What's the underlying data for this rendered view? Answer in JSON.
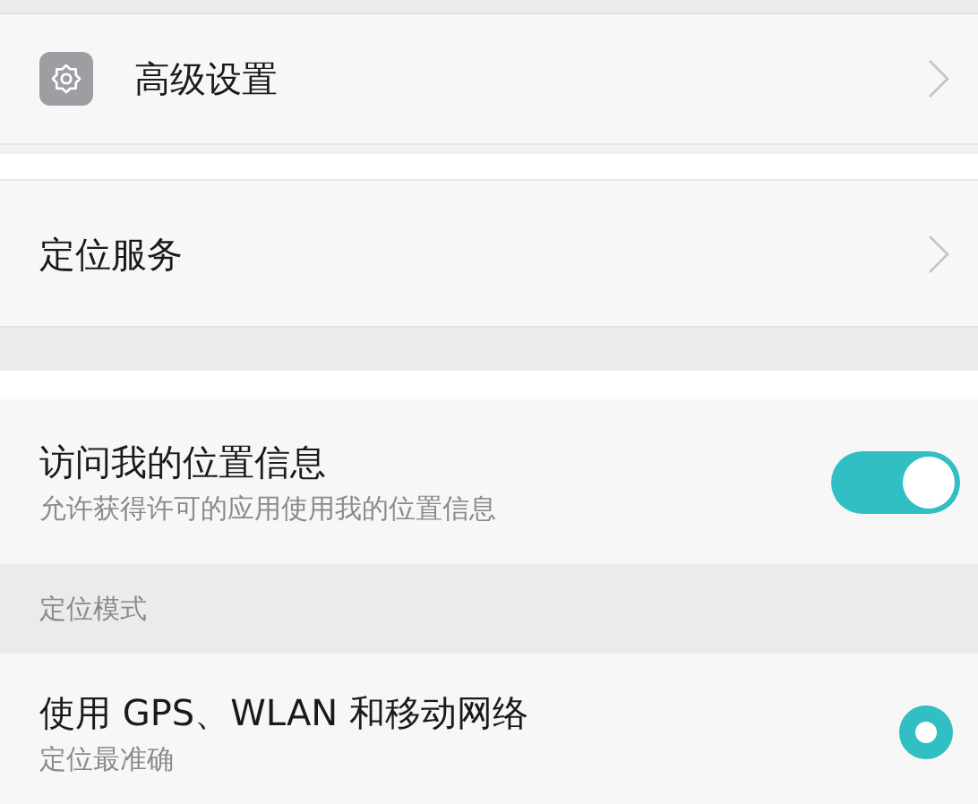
{
  "items": [
    {
      "kind": "link",
      "label": "高级设置",
      "gear_icon": true
    },
    {
      "kind": "link",
      "label": "定位服务",
      "gear_icon": false
    },
    {
      "kind": "toggle",
      "label": "访问我的位置信息",
      "subtitle": "允许获得许可的应用使用我的位置信息",
      "on": true
    },
    {
      "kind": "header",
      "label": "定位模式"
    },
    {
      "kind": "radio",
      "label": "使用 GPS、WLAN 和移动网络",
      "subtitle": "定位最准确",
      "selected": true
    }
  ]
}
